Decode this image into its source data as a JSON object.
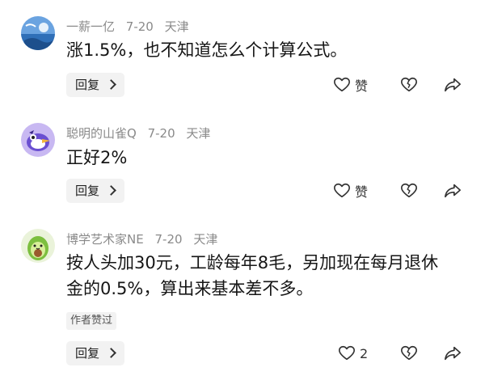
{
  "comments": [
    {
      "username": "一薪一亿",
      "date": "7-20",
      "location": "天津",
      "text": "涨1.5%，也不知道怎么个计算公式。",
      "reply_label": "回复",
      "like_label": "赞",
      "avatar_icon": "blue-sky-avatar",
      "tag": ""
    },
    {
      "username": "聪明的山雀Q",
      "date": "7-20",
      "location": "天津",
      "text": "正好2%",
      "reply_label": "回复",
      "like_label": "赞",
      "avatar_icon": "cartoon-bird-avatar",
      "tag": ""
    },
    {
      "username": "博学艺术家NE",
      "date": "7-20",
      "location": "天津",
      "text": "按人头加30元，工龄每年8毛，另加现在每月退休金的0.5%，算出来基本差不多。",
      "reply_label": "回复",
      "like_label": "2",
      "avatar_icon": "avocado-avatar",
      "tag": "作者赞过"
    }
  ],
  "colors": {
    "meta_text": "#8a8a8a",
    "reply_bg": "#f2f2f2",
    "icon_stroke": "#333333"
  }
}
